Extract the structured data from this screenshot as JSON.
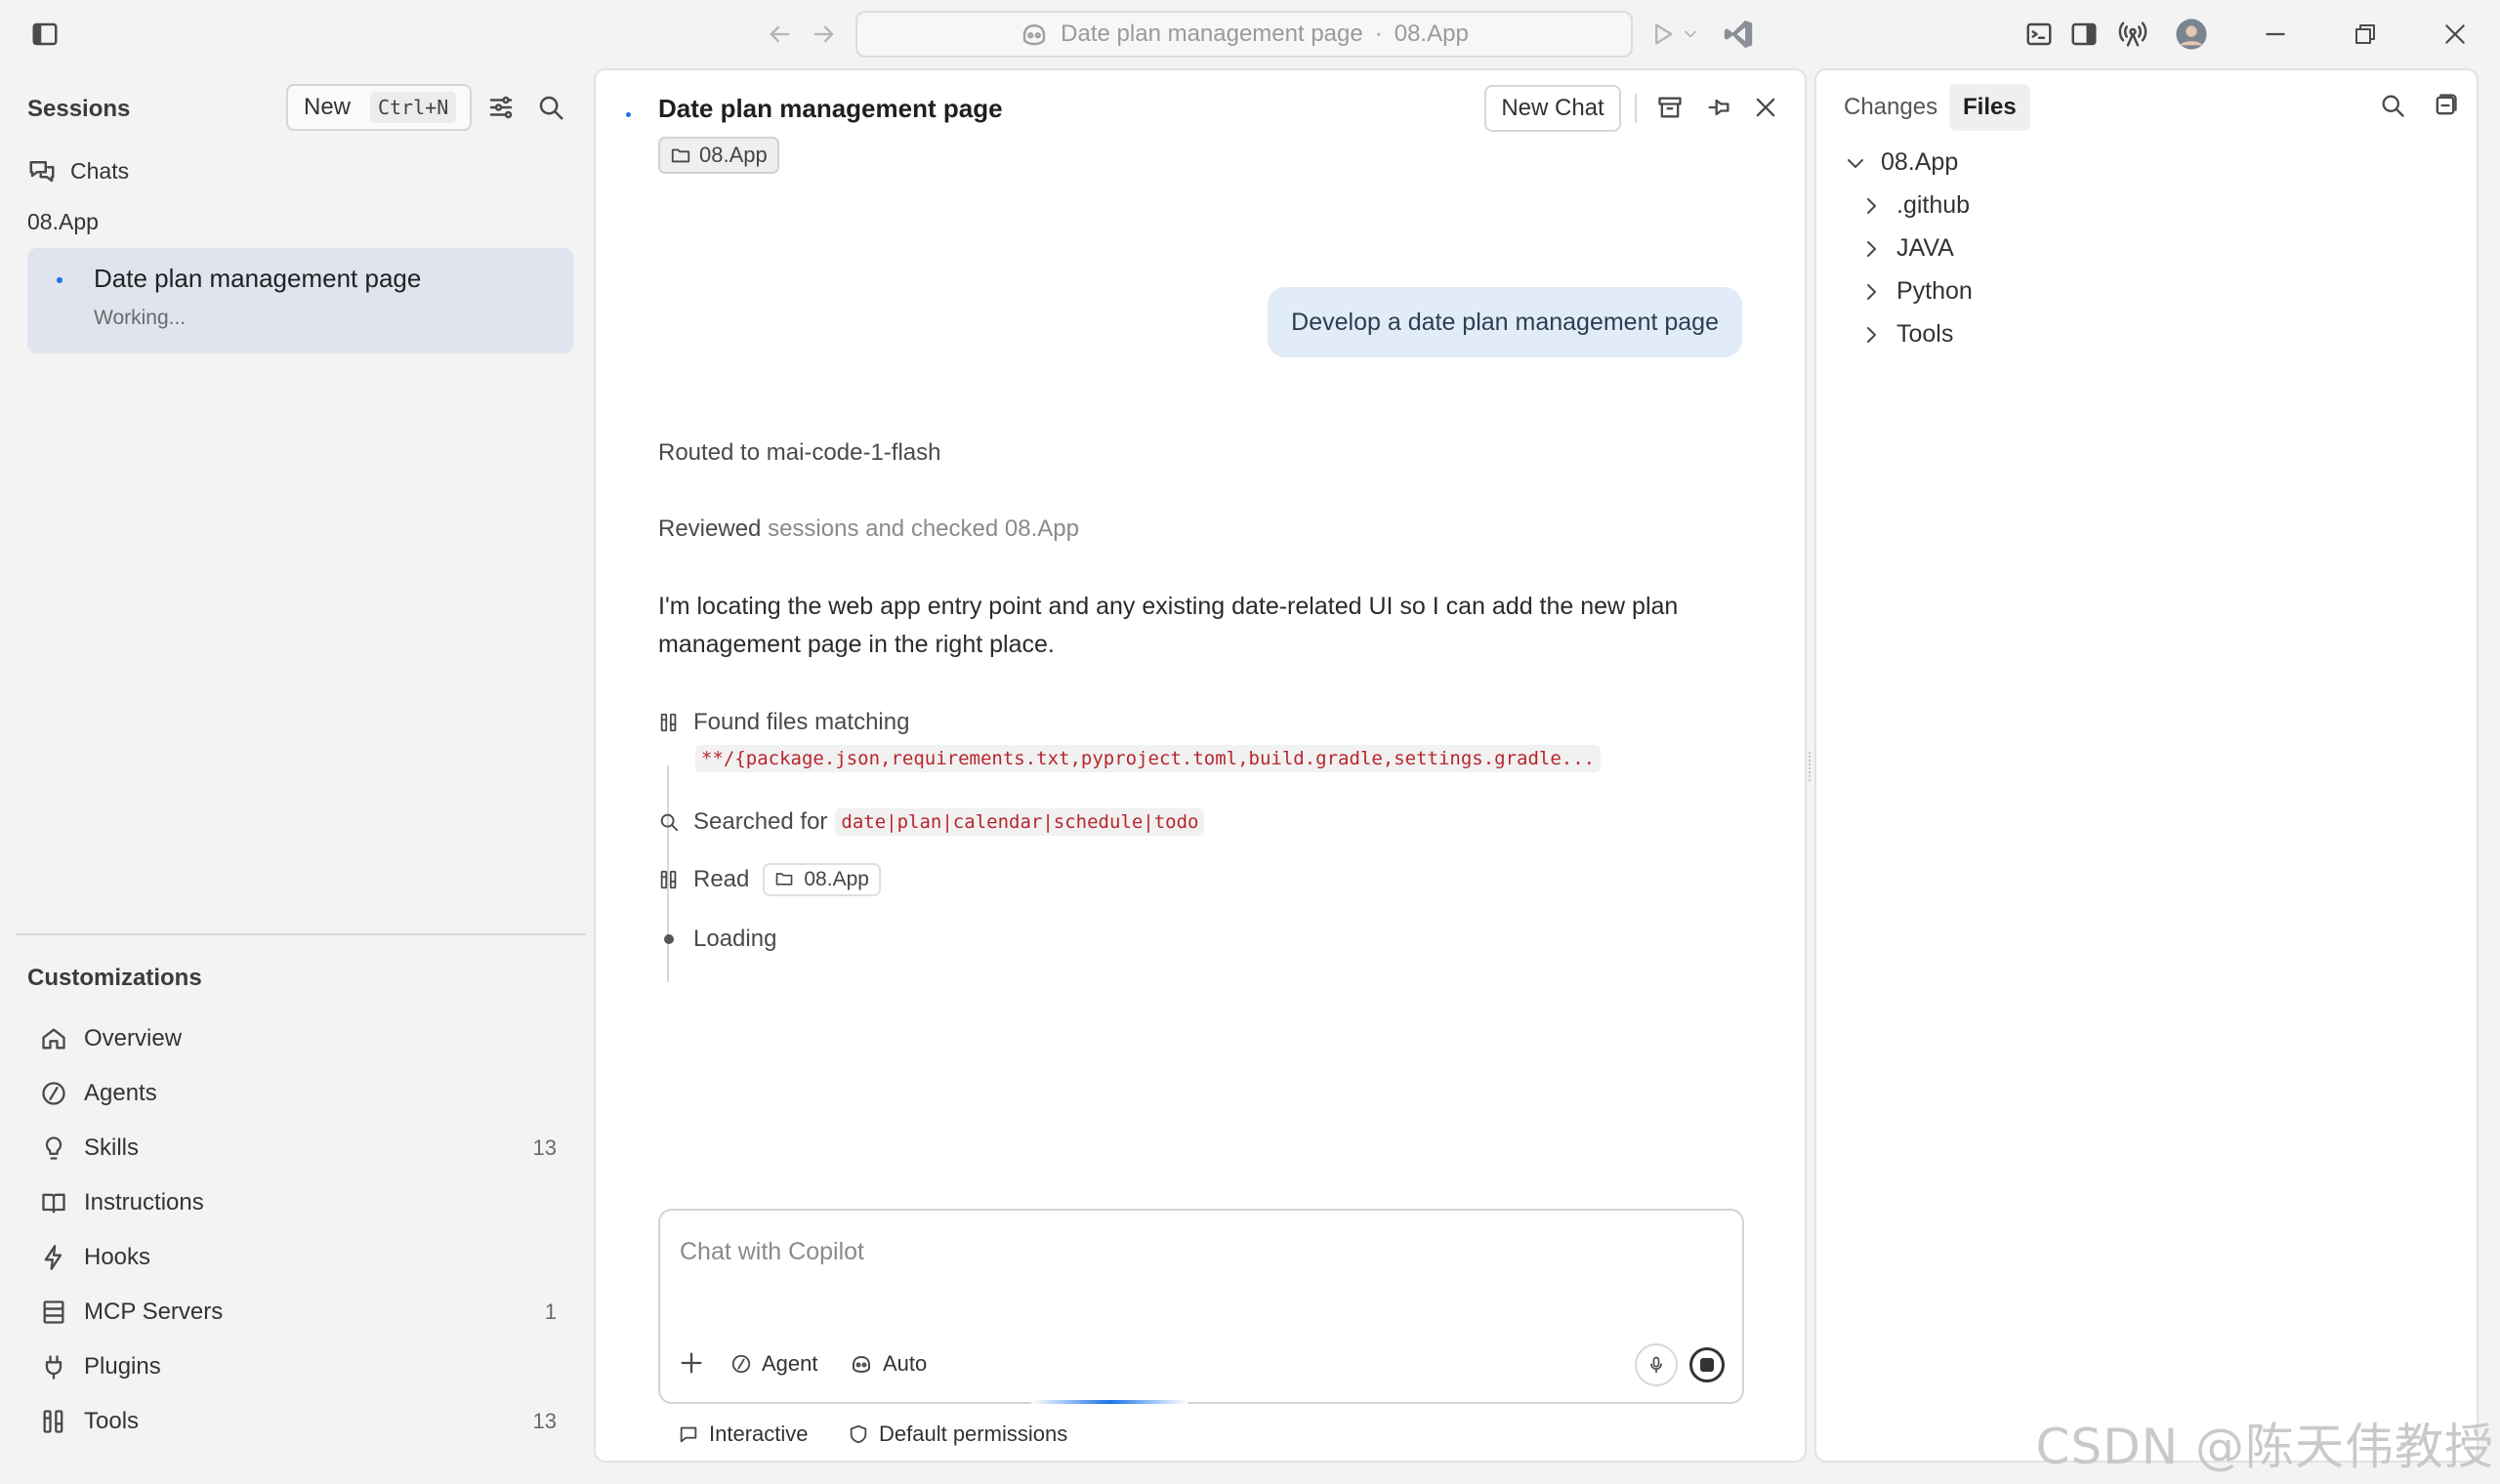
{
  "titlebar": {
    "command_center_title": "Date plan management page",
    "command_center_separator": "·",
    "command_center_workspace": "08.App"
  },
  "sidebar": {
    "sessions_heading": "Sessions",
    "new_label": "New",
    "new_shortcut": "Ctrl+N",
    "chats_label": "Chats",
    "workspace_label": "08.App",
    "session": {
      "title": "Date plan management page",
      "status": "Working..."
    },
    "customizations_heading": "Customizations",
    "items": [
      {
        "label": "Overview",
        "count": "",
        "icon": "home-icon"
      },
      {
        "label": "Agents",
        "count": "",
        "icon": "agent-icon"
      },
      {
        "label": "Skills",
        "count": "13",
        "icon": "lightbulb-icon"
      },
      {
        "label": "Instructions",
        "count": "",
        "icon": "book-icon"
      },
      {
        "label": "Hooks",
        "count": "",
        "icon": "lightning-icon"
      },
      {
        "label": "MCP Servers",
        "count": "1",
        "icon": "server-icon"
      },
      {
        "label": "Plugins",
        "count": "",
        "icon": "plug-icon"
      },
      {
        "label": "Tools",
        "count": "13",
        "icon": "tools-icon"
      }
    ]
  },
  "chat": {
    "title": "Date plan management page",
    "workspace_chip": "08.App",
    "new_chat_label": "New Chat",
    "user_message": "Develop a date plan management page",
    "routed": "Routed to mai-code-1-flash",
    "reviewed_strong": "Reviewed",
    "reviewed_rest": "sessions and checked 08.App",
    "paragraph_line1": "I'm locating the web app entry point and any existing date-related UI so I can add the new plan",
    "paragraph_line2": "management page in the right place.",
    "step_found_label": "Found files matching",
    "step_found_pattern": "**/{package.json,requirements.txt,pyproject.toml,build.gradle,settings.gradle...",
    "step_searched_label": "Searched for",
    "step_searched_pattern": "date|plan|calendar|schedule|todo",
    "step_read_label": "Read",
    "step_read_chip": "08.App",
    "step_loading": "Loading",
    "composer_placeholder": "Chat with Copilot",
    "agent_label": "Agent",
    "auto_label": "Auto",
    "footer_interactive": "Interactive",
    "footer_permissions": "Default permissions"
  },
  "explorer": {
    "tab_changes": "Changes",
    "tab_files": "Files",
    "root": "08.App",
    "children": [
      ".github",
      "JAVA",
      "Python",
      "Tools"
    ]
  },
  "watermark": "CSDN @陈天伟教授",
  "colors": {
    "accent": "#1a73e8",
    "session_bg": "#dfe4ef",
    "user_bubble_bg": "#e1ecf8",
    "code_red": "#b8262c"
  }
}
